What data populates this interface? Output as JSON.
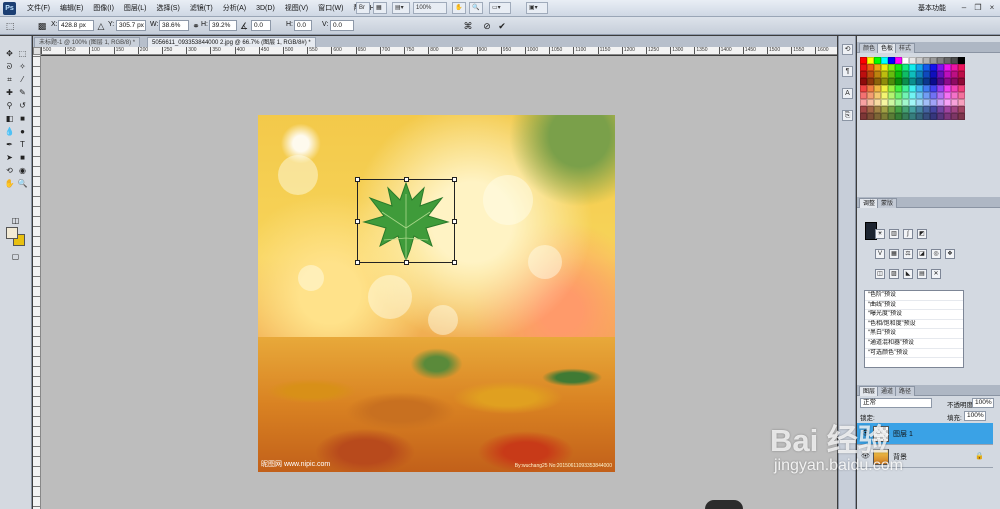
{
  "app": {
    "logo": "Ps",
    "menus": [
      "文件(F)",
      "编辑(E)",
      "图像(I)",
      "图层(L)",
      "选择(S)",
      "滤镜(T)",
      "分析(A)",
      "3D(D)",
      "视图(V)",
      "窗口(W)",
      "帮助(H)"
    ],
    "workspace": "基本功能",
    "zoom_dropdown": "100%"
  },
  "options": {
    "x_label": "X:",
    "x_value": "428.8 px",
    "y_label": "Y:",
    "y_value": "305.7 px",
    "w_label": "W:",
    "w_value": "38.6%",
    "h_label": "H:",
    "h_value": "39.2%",
    "angle_value": "0.0",
    "hskew_label": "H:",
    "hskew_value": "0.0",
    "vskew_label": "V:",
    "vskew_value": "0.0"
  },
  "tabs": [
    {
      "label": "未标题-1 @ 100% (图层 1, RGB/8) *",
      "active": false
    },
    {
      "label": "5056611_093353844000 2.jpg @ 66.7% (图层 1, RGB/8#) *",
      "active": true
    }
  ],
  "ruler_labels": [
    "500",
    "550",
    "100",
    "150",
    "200",
    "250",
    "300",
    "350",
    "400",
    "450",
    "500",
    "550",
    "600",
    "650",
    "700",
    "750",
    "800",
    "850",
    "900",
    "950",
    "1000",
    "1050",
    "1100",
    "1150",
    "1200",
    "1250",
    "1300",
    "1350",
    "1400",
    "1450",
    "1500",
    "1550",
    "1600"
  ],
  "image": {
    "watermark_left": "昵图网 www.nipic.com",
    "watermark_right": "By:wuchang25 No:20150611093353844000"
  },
  "panels": {
    "swatches_tabs": [
      "颜色",
      "色板",
      "样式"
    ],
    "adjustments_tabs": [
      "调整",
      "蒙版"
    ],
    "presets": [
      "“色阶”预设",
      "“曲线”预设",
      "“曝光度”预设",
      "“色相/饱和度”预设",
      "“黑白”预设",
      "“通道混和器”预设",
      "“可选颜色”预设"
    ],
    "layers_tabs": [
      "图层",
      "通道",
      "路径"
    ],
    "blend_mode": "正常",
    "opacity_label": "不透明度:",
    "opacity_value": "100%",
    "lock_label": "锁定:",
    "fill_label": "填充:",
    "fill_value": "100%",
    "layers": [
      {
        "name": "图层 1",
        "selected": true
      },
      {
        "name": "背景",
        "selected": false
      }
    ]
  },
  "watermark": {
    "logo": "Bai 经验",
    "url": "jingyan.baidu.com"
  },
  "colors": {
    "foreground": "#f2ead4",
    "background": "#e8c010",
    "selection": "#3aa2e6"
  }
}
